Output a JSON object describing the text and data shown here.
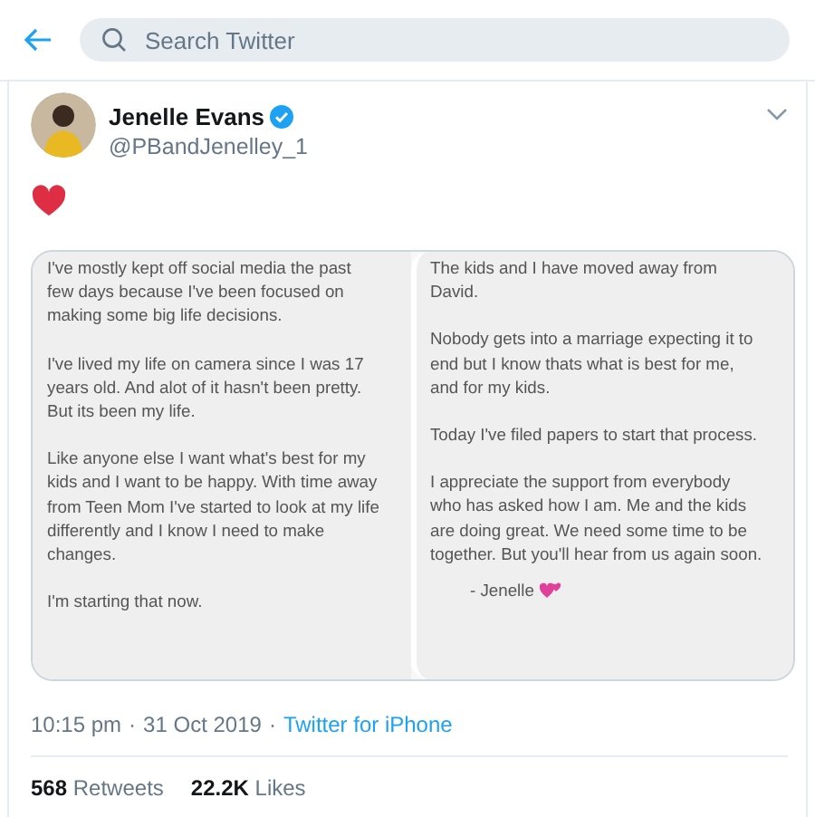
{
  "search": {
    "placeholder": "Search Twitter"
  },
  "tweet": {
    "name": "Jenelle Evans",
    "verified": true,
    "handle": "@PBandJenelley_1",
    "image": {
      "columns": [
        {
          "paragraphs": [
            "I've mostly kept off social media the past few days because I've been focused on making some big life decisions.",
            "I've lived my life on camera since I was 17 years old. And alot of it hasn't been pretty. But its been my life.",
            "Like anyone else I want what's best for my kids and I want to be happy. With time away from Teen Mom I've started to look at my life differently and I know I need to make changes.",
            "I'm starting that now."
          ]
        },
        {
          "paragraphs": [
            "The kids and I have moved away from David.",
            "Nobody gets into a marriage expecting it to end but I know thats what is best for me, and for my kids.",
            "Today I've filed papers to start that process.",
            "I appreciate the support from everybody who has asked how I am. Me and the kids are doing great. We need some time to be together. But you'll hear from us again soon."
          ]
        }
      ],
      "signature": "-  Jenelle"
    },
    "time": "10:15 pm",
    "separators": [
      "·",
      "·"
    ],
    "date": "31 Oct 2019",
    "source": "Twitter for iPhone",
    "stats": [
      {
        "count": "568",
        "label": "Retweets"
      },
      {
        "count": "22.2K",
        "label": "Likes"
      }
    ]
  }
}
